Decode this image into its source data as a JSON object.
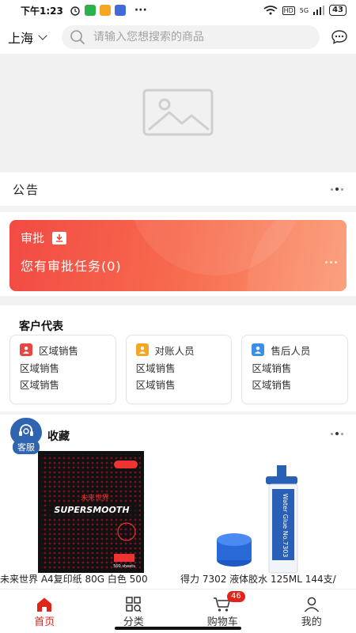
{
  "status_bar": {
    "time": "下午1:23",
    "signal": "5G",
    "battery": "43",
    "hd": "HD"
  },
  "header": {
    "city": "上海",
    "search_placeholder": "请输入您想搜索的商品"
  },
  "notice": {
    "title": "公告"
  },
  "approval": {
    "title": "审批",
    "message": "您有审批任务(0)"
  },
  "customer_rep": {
    "title": "客户代表",
    "cards": [
      {
        "role": "区域销售",
        "line1": "区域销售",
        "line2": "区域销售",
        "color": "#e8463e"
      },
      {
        "role": "对账人员",
        "line1": "区域销售",
        "line2": "区域销售",
        "color": "#f5a623"
      },
      {
        "role": "售后人员",
        "line1": "区域销售",
        "line2": "区域销售",
        "color": "#3b8fe8"
      }
    ]
  },
  "favorites": {
    "title": "收藏",
    "products": [
      {
        "name": "未来世界 A4复印纸 80G 白色 500"
      },
      {
        "name": "得力 7302 液体胶水 125ML 144支/"
      }
    ]
  },
  "service": {
    "label": "客服"
  },
  "tabbar": {
    "items": [
      {
        "label": "首页"
      },
      {
        "label": "分类"
      },
      {
        "label": "购物车"
      },
      {
        "label": "我的"
      }
    ],
    "cart_count": "46",
    "active_color": "#e2231a"
  }
}
